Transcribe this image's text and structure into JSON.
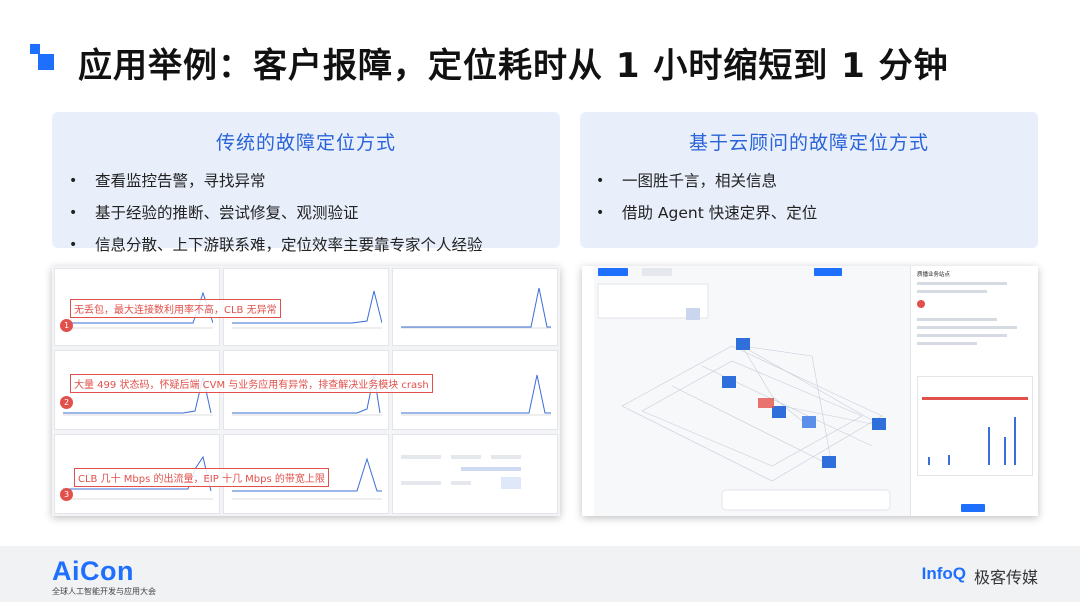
{
  "title": "应用举例：客户报障，定位耗时从 1 小时缩短到 1 分钟",
  "left_panel": {
    "heading": "传统的故障定位方式",
    "bullets": [
      "查看监控告警，寻找异常",
      "基于经验的推断、尝试修复、观测验证",
      "信息分散、上下游联系难，定位效率主要靠专家个人经验"
    ]
  },
  "right_panel": {
    "heading": "基于云顾问的故障定位方式",
    "bullets": [
      "一图胜千言，相关信息",
      "借助 Agent 快速定界、定位"
    ]
  },
  "left_screenshot": {
    "annotations": [
      {
        "num": "1",
        "text": "无丢包，最大连接数利用率不高，CLB 无异常"
      },
      {
        "num": "2",
        "text": "大量 499 状态码，怀疑后端 CVM 与业务应用有异常，排查解决业务模块 crash"
      },
      {
        "num": "3",
        "text": "CLB 几十 Mbps 的出流量，EIP 十几 Mbps 的带宽上限"
      }
    ]
  },
  "right_screenshot": {
    "breadcrumb": "质播业务站点"
  },
  "bullet_marker": "•",
  "footer": {
    "brand": "AiCon",
    "brand_sub": "全球人工智能开发与应用大会",
    "partner": "InfoQ",
    "partner_cn": "极客传媒"
  },
  "colors": {
    "accent": "#1f6fff",
    "panel_bg": "#e8effb",
    "panel_heading": "#2a63d8",
    "annotation": "#e2504b"
  }
}
